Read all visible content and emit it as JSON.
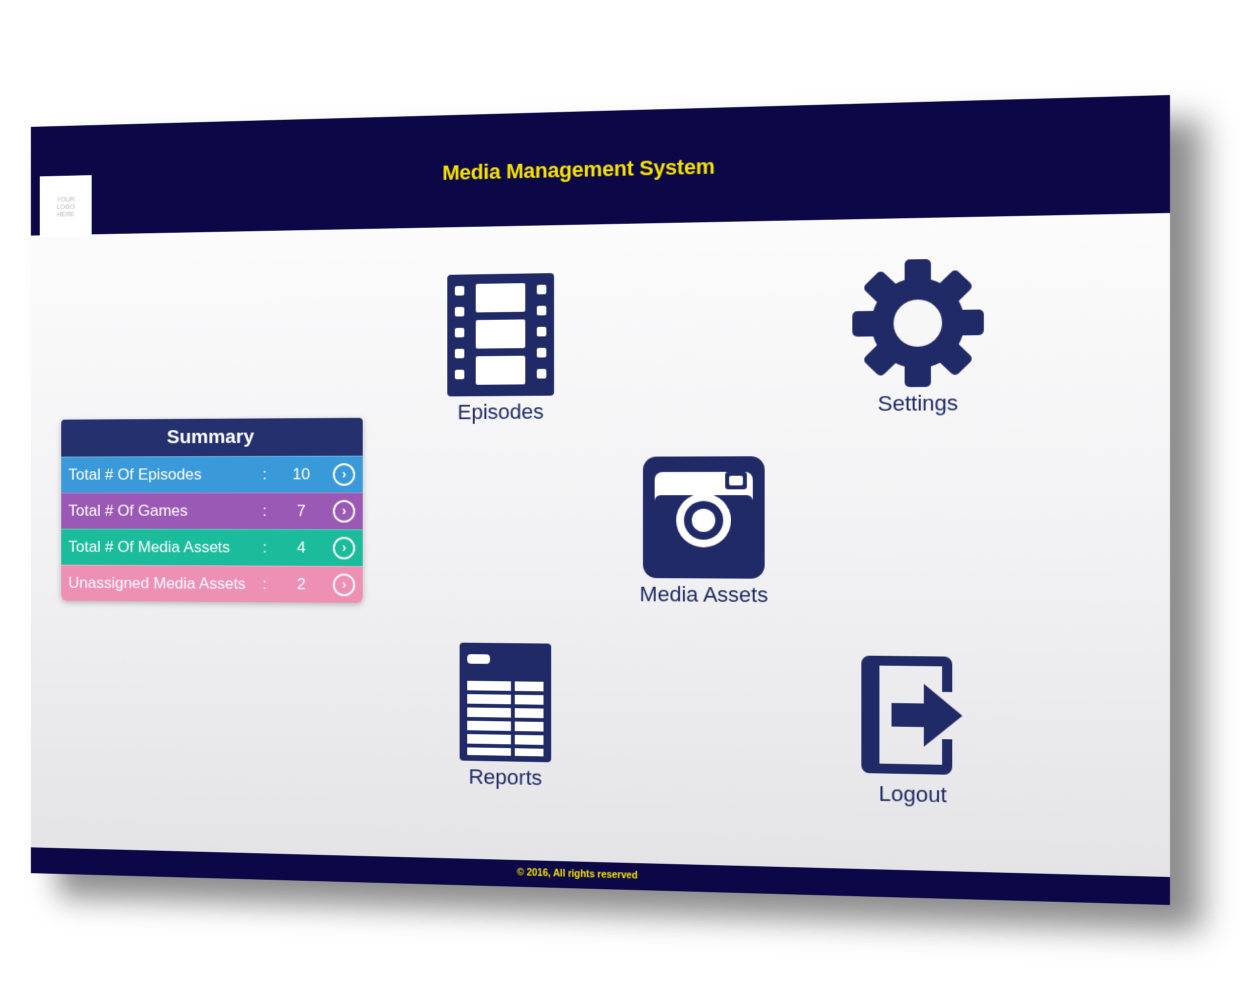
{
  "header": {
    "logo_text": "YOUR\nLOGO\nHERE",
    "title": "Media Management System"
  },
  "summary": {
    "title": "Summary",
    "rows": [
      {
        "label": "Total # Of Episodes",
        "colon": ":",
        "value": "10",
        "color": "#3a9ad9"
      },
      {
        "label": "Total # Of Games",
        "colon": ":",
        "value": "7",
        "color": "#9b59b6"
      },
      {
        "label": "Total # Of Media Assets",
        "colon": ":",
        "value": "4",
        "color": "#1abc9c"
      },
      {
        "label": "Unassigned Media Assets",
        "colon": ":",
        "value": "2",
        "color": "#ee8fb4"
      }
    ]
  },
  "tiles": {
    "episodes": {
      "label": "Episodes",
      "icon": "film-icon"
    },
    "settings": {
      "label": "Settings",
      "icon": "gear-icon"
    },
    "media_assets": {
      "label": "Media Assets",
      "icon": "camera-icon"
    },
    "reports": {
      "label": "Reports",
      "icon": "report-table-icon"
    },
    "logout": {
      "label": "Logout",
      "icon": "logout-icon"
    }
  },
  "footer": {
    "copyright": "© 2016, All rights reserved"
  },
  "colors": {
    "header_bg": "#0c0848",
    "title": "#f5e100",
    "icon": "#1f2a66",
    "summary_header": "#25306e"
  }
}
